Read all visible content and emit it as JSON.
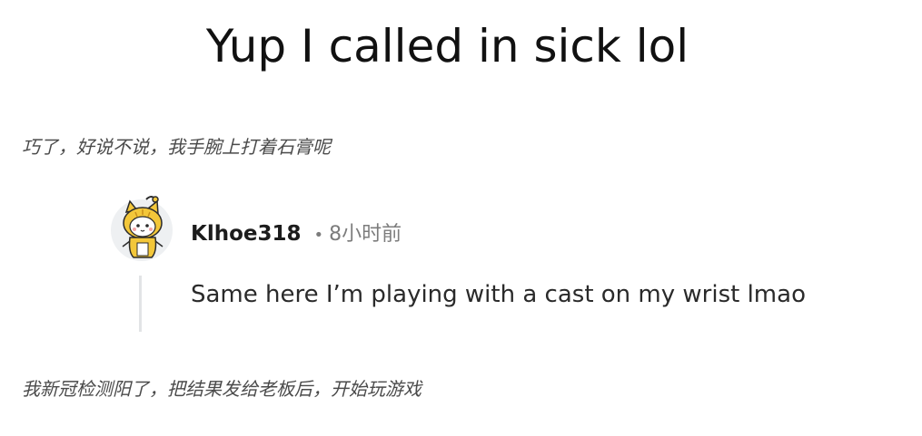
{
  "post": {
    "title": "Yup I called in sick lol"
  },
  "captions": {
    "first": "巧了，好说不说，我手腕上打着石膏呢",
    "second": "我新冠检测阳了，把结果发给老板后，开始玩游戏"
  },
  "comment": {
    "username": "Klhoe318",
    "separator": "•",
    "time": "8小时前",
    "text": "Same here I’m playing with a cast on my wrist lmao",
    "avatar_icon": "yellow-cat-avatar-icon"
  },
  "colors": {
    "thread_line": "#e2e4e6",
    "meta_gray": "#7c7c7c",
    "avatar_yellow": "#f3c73a"
  }
}
